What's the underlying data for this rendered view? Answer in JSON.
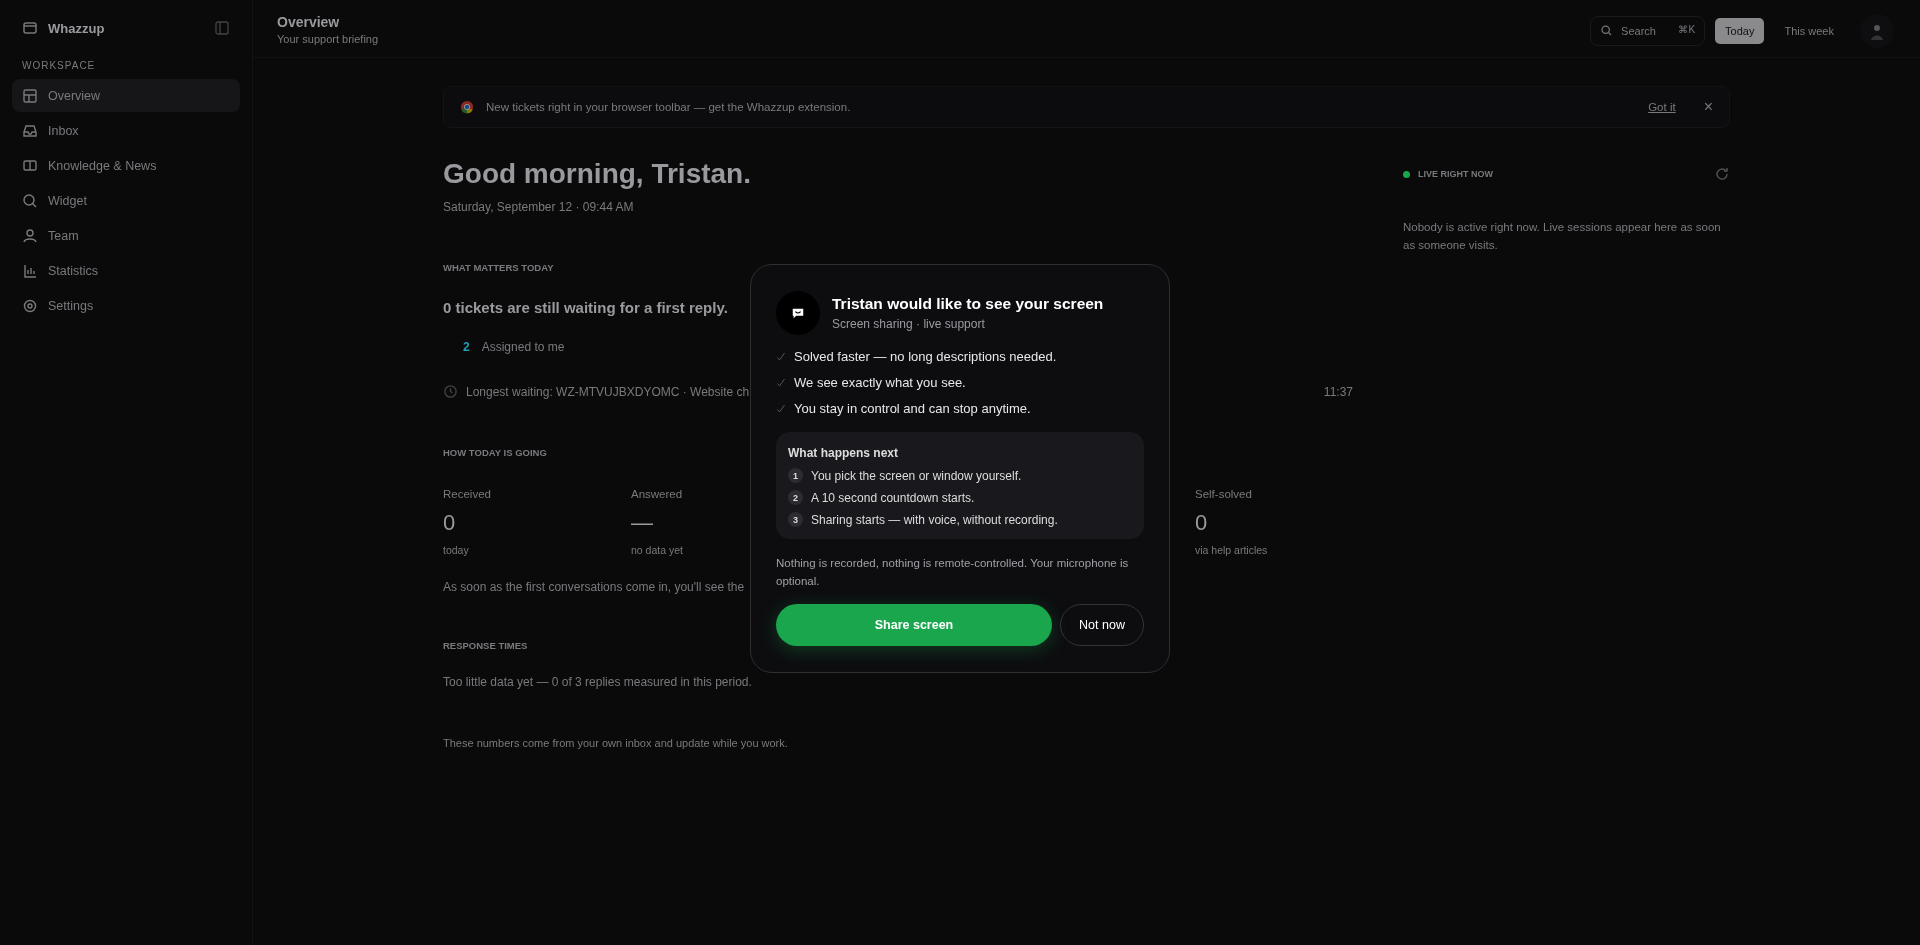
{
  "sidebar": {
    "brand": "Whazzup",
    "section": "WORKSPACE",
    "items": [
      {
        "label": "Overview",
        "selected": true
      },
      {
        "label": "Inbox",
        "selected": false
      },
      {
        "label": "Knowledge & News",
        "selected": false
      },
      {
        "label": "Widget",
        "selected": false
      },
      {
        "label": "Team",
        "selected": false
      },
      {
        "label": "Statistics",
        "selected": false
      },
      {
        "label": "Settings",
        "selected": false
      }
    ]
  },
  "header": {
    "title": "Overview",
    "subtitle": "Your support briefing",
    "search": {
      "placeholder": "Search",
      "shortcut": "⌘K"
    },
    "ranges": [
      {
        "label": "Today",
        "selected": true
      },
      {
        "label": "This week",
        "selected": false
      }
    ]
  },
  "banner": {
    "text": "New tickets right in your browser toolbar — get the Whazzup extension.",
    "action": "Got it",
    "close": "×"
  },
  "greeting": {
    "title": "Good morning, Tristan.",
    "date": "Saturday, September 12 · 09:44 AM"
  },
  "today": {
    "heading": "WHAT MATTERS TODAY",
    "summary": "0 tickets are still waiting for a first reply.",
    "assigned": {
      "count": "2",
      "label": "Assigned to me"
    },
    "longest": {
      "text": "Longest waiting: WZ-MTVUJBXDYOMC · Website ch",
      "time": "11:37"
    }
  },
  "stats": {
    "heading": "HOW TODAY IS GOING",
    "items": [
      {
        "label": "Received",
        "value": "0",
        "note": "today"
      },
      {
        "label": "Answered",
        "value": "—",
        "note": "no data yet"
      },
      {
        "label": "Self-solved",
        "value": "0",
        "note": "via help articles"
      }
    ],
    "hint": "As soon as the first conversations come in, you'll see the"
  },
  "response": {
    "heading": "RESPONSE TIMES",
    "text": "Too little data yet — 0 of 3 replies measured in this period."
  },
  "footnote": "These numbers come from your own inbox and update while you work.",
  "live": {
    "heading": "LIVE RIGHT NOW",
    "text": "Nobody is active right now. Live sessions appear here as soon as someone visits."
  },
  "modal": {
    "title": "Tristan would like to see your screen",
    "subtitle": "Screen sharing · live support",
    "benefits": [
      "Solved faster — no long descriptions needed.",
      "We see exactly what you see.",
      "You stay in control and can stop anytime."
    ],
    "steps_title": "What happens next",
    "steps": [
      {
        "number": "1",
        "text": "You pick the screen or window yourself."
      },
      {
        "number": "2",
        "text": "A 10 second countdown starts."
      },
      {
        "number": "3",
        "text": "Sharing starts — with voice, without recording."
      }
    ],
    "note": "Nothing is recorded, nothing is remote-controlled. Your microphone is optional.",
    "primary": "Share screen",
    "secondary": "Not now"
  }
}
